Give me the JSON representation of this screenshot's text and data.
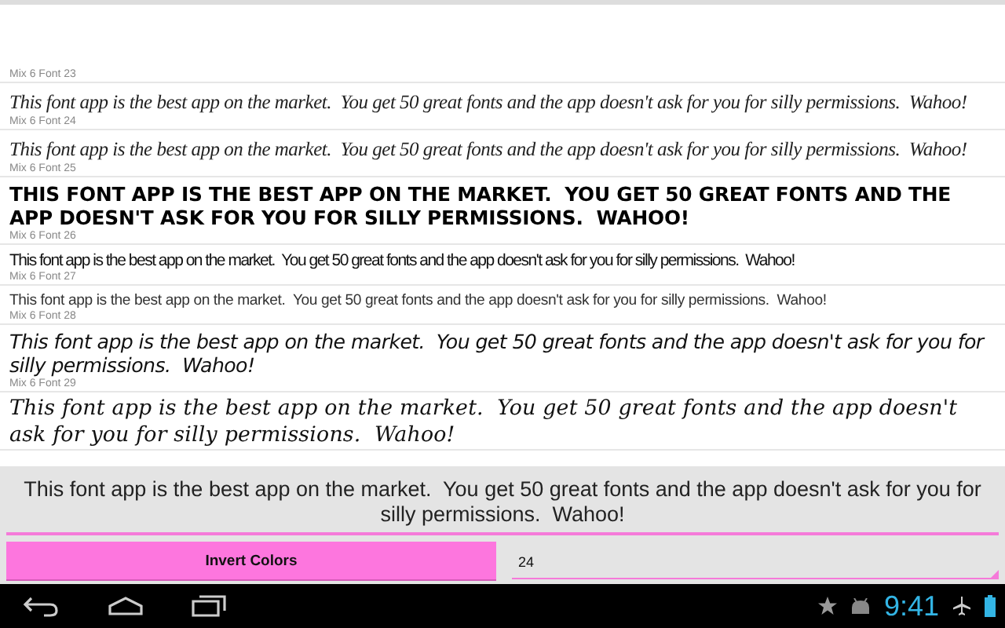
{
  "font_list": [
    {
      "label": "Mix 6 Font 23"
    },
    {
      "kind": "script",
      "sample": "This font app is the best app on the market.  You get 50 great fonts and the app doesn't ask for you for silly permissions.  Wahoo!",
      "label": "Mix 6 Font 24"
    },
    {
      "kind": "script",
      "sample": "This font app is the best app on the market.  You get 50 great fonts and the app doesn't ask for you for silly permissions.  Wahoo!",
      "label": "Mix 6 Font 25"
    },
    {
      "kind": "bold-caps",
      "sample": "THIS FONT APP IS THE BEST APP ON THE MARKET.  YOU GET 50 GREAT FONTS AND THE APP DOESN'T ASK FOR YOU FOR SILLY PERMISSIONS.  WAHOO!",
      "label": "Mix 6 Font 26"
    },
    {
      "kind": "condensed",
      "sample": "This font app is the best app on the market.  You get 50 great fonts and the app doesn't ask for you for silly permissions.  Wahoo!",
      "label": "Mix 6 Font 27"
    },
    {
      "kind": "thin",
      "sample": "This font app is the best app on the market.  You get 50 great fonts and the app doesn't ask for you for silly permissions.  Wahoo!",
      "label": "Mix 6 Font 28"
    },
    {
      "kind": "italic",
      "sample": "This font app is the best app on the market.  You get 50 great fonts and the app doesn't ask for you for silly permissions.  Wahoo!",
      "label": "Mix 6 Font 29"
    },
    {
      "kind": "handwriting",
      "sample": "This font app is the best app on the market.  You get 50 great fonts and the app doesn't ask for you for silly permissions.  Wahoo!"
    }
  ],
  "text_input": {
    "value": "This font app is the best app on the market.  You get 50 great fonts and the app doesn't ask for you for silly permissions.  Wahoo!"
  },
  "invert_button": {
    "label": "Invert Colors"
  },
  "size_field": {
    "value": "24"
  },
  "status_bar": {
    "time": "9:41"
  }
}
